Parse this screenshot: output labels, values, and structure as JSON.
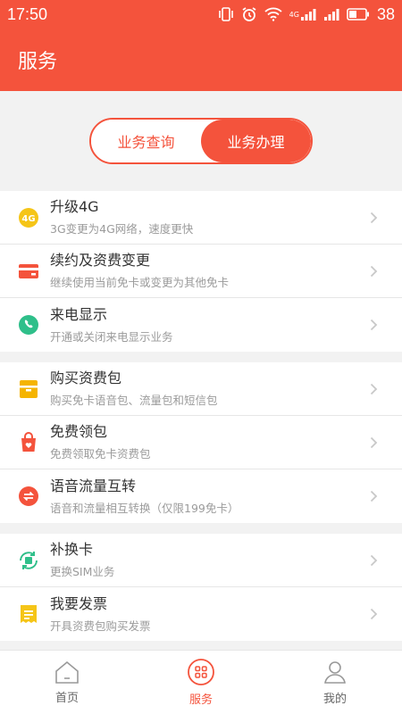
{
  "status": {
    "time": "17:50",
    "battery": "38",
    "network": "4G"
  },
  "header": {
    "title": "服务"
  },
  "segments": [
    {
      "label": "业务查询",
      "selected": false
    },
    {
      "label": "业务办理",
      "selected": true
    }
  ],
  "groups": [
    {
      "items": [
        {
          "title": "升级4G",
          "subtitle": "3G变更为4G网络，速度更快",
          "icon": "4g-icon",
          "color": "#f5c518"
        },
        {
          "title": "续约及资费变更",
          "subtitle": "继续使用当前免卡或变更为其他免卡",
          "icon": "card-icon",
          "color": "#f4533c"
        },
        {
          "title": "来电显示",
          "subtitle": "开通或关闭来电显示业务",
          "icon": "phone-icon",
          "color": "#2fbf8a"
        }
      ]
    },
    {
      "items": [
        {
          "title": "购买资费包",
          "subtitle": "购买免卡语音包、流量包和短信包",
          "icon": "package-icon",
          "color": "#f5b400"
        },
        {
          "title": "免费领包",
          "subtitle": "免费领取免卡资费包",
          "icon": "gift-bag-icon",
          "color": "#f4533c"
        },
        {
          "title": "语音流量互转",
          "subtitle": "语音和流量相互转换（仅限199免卡）",
          "icon": "swap-icon",
          "color": "#f4533c"
        }
      ]
    },
    {
      "items": [
        {
          "title": "补换卡",
          "subtitle": "更换SIM业务",
          "icon": "sim-replace-icon",
          "color": "#2fbf8a"
        },
        {
          "title": "我要发票",
          "subtitle": "开具资费包购买发票",
          "icon": "invoice-icon",
          "color": "#f5c518"
        }
      ]
    }
  ],
  "tabs": [
    {
      "label": "首页",
      "icon": "home-icon",
      "active": false
    },
    {
      "label": "服务",
      "icon": "service-grid-icon",
      "active": true
    },
    {
      "label": "我的",
      "icon": "user-icon",
      "active": false
    }
  ],
  "colors": {
    "accent": "#f4533c"
  }
}
